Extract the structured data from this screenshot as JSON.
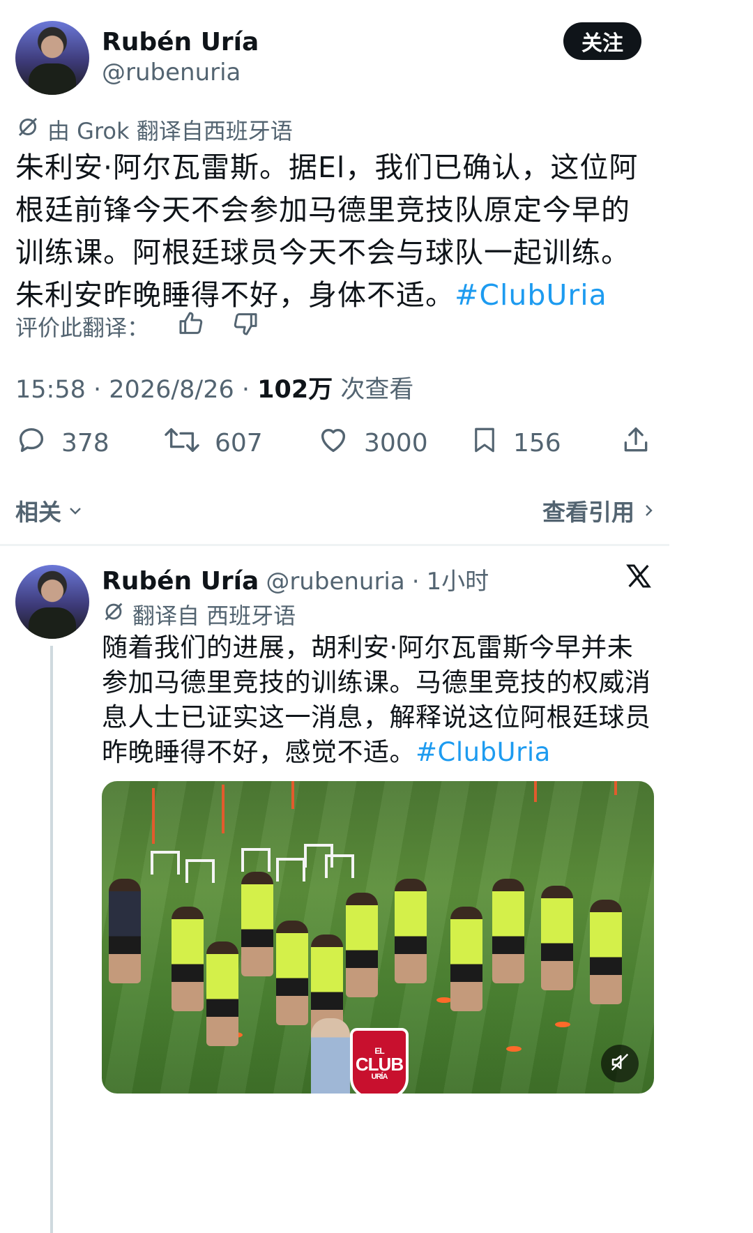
{
  "tweet": {
    "author_name": "Rubén Uría",
    "author_handle": "@rubenuria",
    "follow_label": "关注",
    "translation_note": "由 Grok 翻译自西班牙语",
    "text": "朱利安·阿尔瓦雷斯。据El，我们已确认，这位阿根廷前锋今天不会参加马德里竞技队原定今早的训练课。阿根廷球员今天不会与球队一起训练。朱利安昨晚睡得不好，身体不适。",
    "hashtag": "#ClubUria",
    "rate_label": "评价此翻译：",
    "time": "15:58",
    "date": "2026/8/26",
    "views_count": "102万",
    "views_label": "次查看",
    "replies": "378",
    "retweets": "607",
    "likes": "3000",
    "bookmarks": "156"
  },
  "related_bar": {
    "related_label": "相关",
    "view_quotes_label": "查看引用"
  },
  "quoted": {
    "author_name": "Rubén Uría",
    "author_handle": "@rubenuria",
    "time_ago": "1小时",
    "translation_note": "翻译自 西班牙语",
    "text": "随着我们的进展，胡利安·阿尔瓦雷斯今早并未参加马德里竞技的训练课。马德里竞技的权威消息人士已证实这一消息，解释说这位阿根廷球员昨晚睡得不好，感觉不适。",
    "hashtag": "#ClubUria",
    "logo_text": "CLUB",
    "logo_top": "EL",
    "logo_bottom": "URÍA"
  },
  "icons": {
    "translate": "grok-translate-icon",
    "thumbs_up": "thumbs-up-icon",
    "thumbs_down": "thumbs-down-icon",
    "reply": "reply-icon",
    "retweet": "retweet-icon",
    "like": "heart-icon",
    "bookmark": "bookmark-icon",
    "share": "share-icon",
    "x_logo": "x-logo-icon",
    "mute": "mute-icon"
  }
}
